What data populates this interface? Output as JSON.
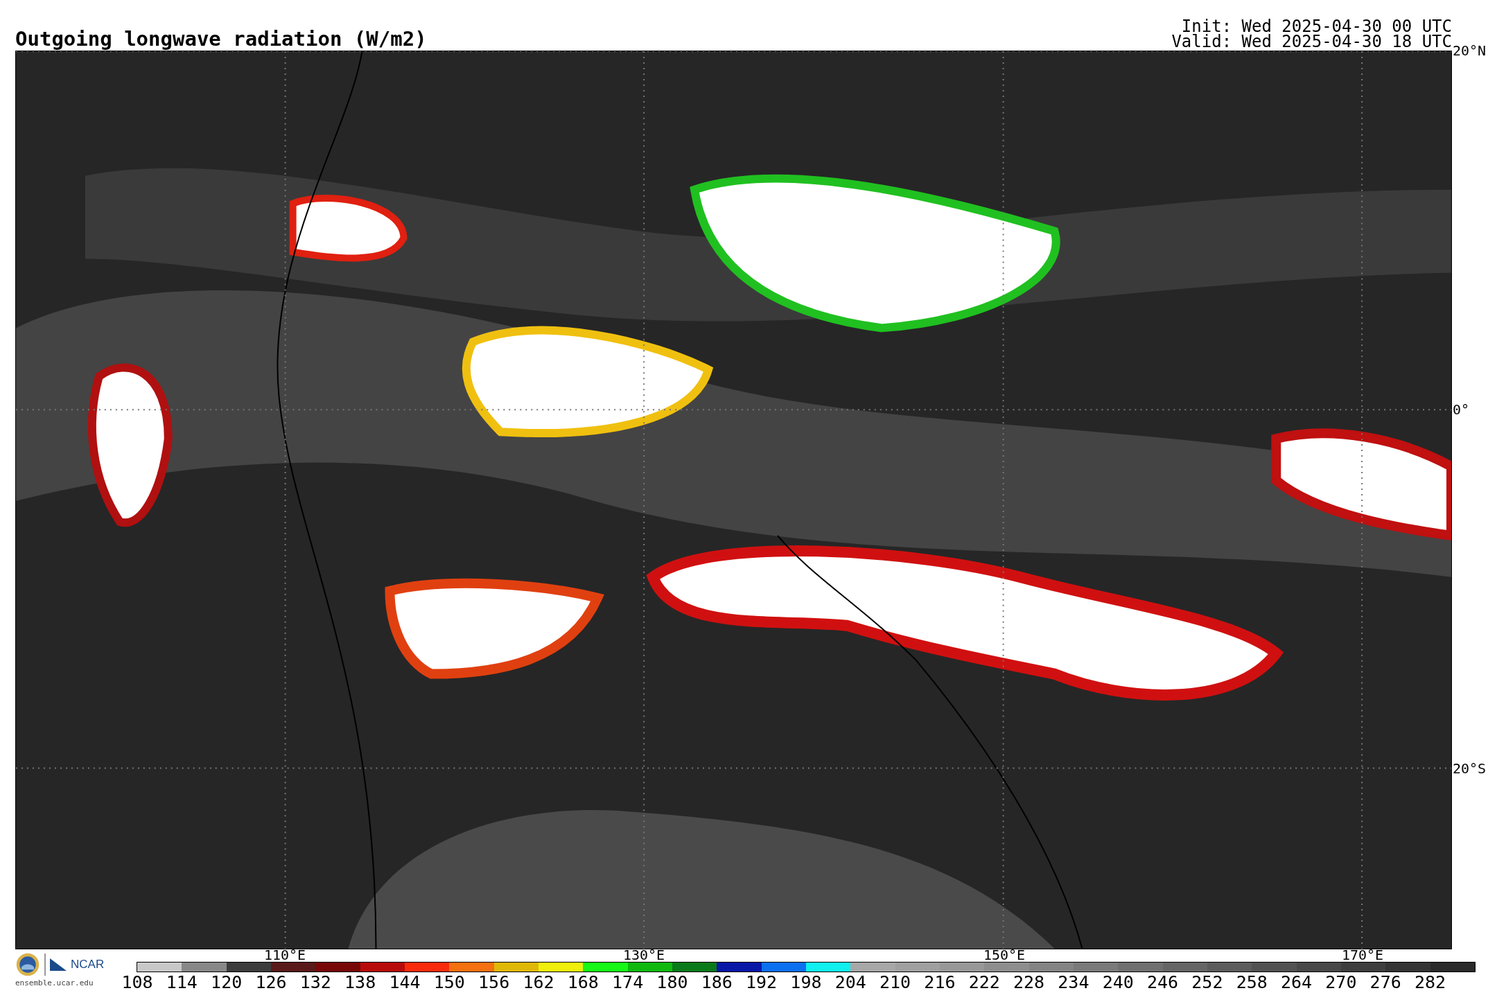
{
  "title": "Outgoing longwave radiation (W/m2)",
  "init": "Init: Wed 2025-04-30 00 UTC",
  "valid": "Valid: Wed 2025-04-30 18 UTC",
  "map": {
    "lat_labels": [
      "20°N",
      "0°",
      "20°S"
    ],
    "lon_labels": [
      "110°E",
      "130°E",
      "150°E",
      "170°E"
    ]
  },
  "logo": {
    "name": "NCAR",
    "site": "ensemble.ucar.edu"
  },
  "colorbar": [
    {
      "label": "108",
      "color": "#c8c8c8"
    },
    {
      "label": "114",
      "color": "#888888"
    },
    {
      "label": "120",
      "color": "#3c3c3c"
    },
    {
      "label": "126",
      "color": "#5a1a1a"
    },
    {
      "label": "132",
      "color": "#780808"
    },
    {
      "label": "138",
      "color": "#b80c0c"
    },
    {
      "label": "144",
      "color": "#f82c0c"
    },
    {
      "label": "150",
      "color": "#f47010"
    },
    {
      "label": "156",
      "color": "#e0b808"
    },
    {
      "label": "162",
      "color": "#f0f00c"
    },
    {
      "label": "168",
      "color": "#18f818"
    },
    {
      "label": "174",
      "color": "#10b810"
    },
    {
      "label": "180",
      "color": "#0a7a1a"
    },
    {
      "label": "186",
      "color": "#0a18a8"
    },
    {
      "label": "192",
      "color": "#0c70f0"
    },
    {
      "label": "198",
      "color": "#10f0f0"
    },
    {
      "label": "204",
      "color": "#a8a8a8"
    },
    {
      "label": "210",
      "color": "#a0a0a0"
    },
    {
      "label": "216",
      "color": "#989898"
    },
    {
      "label": "222",
      "color": "#8e8e8e"
    },
    {
      "label": "228",
      "color": "#848484"
    },
    {
      "label": "234",
      "color": "#7a7a7a"
    },
    {
      "label": "240",
      "color": "#707070"
    },
    {
      "label": "246",
      "color": "#666666"
    },
    {
      "label": "252",
      "color": "#5c5c5c"
    },
    {
      "label": "258",
      "color": "#525252"
    },
    {
      "label": "264",
      "color": "#484848"
    },
    {
      "label": "270",
      "color": "#3e3e3e"
    },
    {
      "label": "276",
      "color": "#343434"
    },
    {
      "label": "282",
      "color": "#2a2a2a"
    }
  ]
}
